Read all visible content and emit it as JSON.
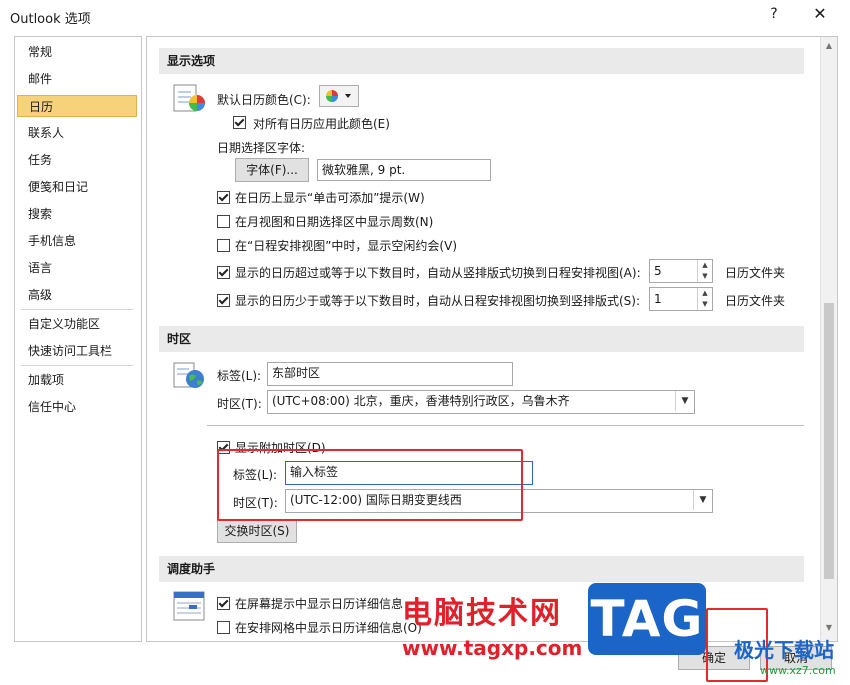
{
  "window": {
    "title": "Outlook 选项",
    "help": "?",
    "close": "✕"
  },
  "nav": {
    "items": [
      {
        "label": "常规"
      },
      {
        "label": "邮件"
      },
      {
        "label": "日历"
      },
      {
        "label": "联系人"
      },
      {
        "label": "任务"
      },
      {
        "label": "便笺和日记"
      },
      {
        "label": "搜索"
      },
      {
        "label": "手机信息"
      },
      {
        "label": "语言"
      },
      {
        "label": "高级"
      },
      {
        "label": "自定义功能区"
      },
      {
        "label": "快速访问工具栏"
      },
      {
        "label": "加载项"
      },
      {
        "label": "信任中心"
      }
    ],
    "selected": "日历"
  },
  "display": {
    "header": "显示选项",
    "default_color_label": "默认日历颜色(C):",
    "apply_all_label": "对所有日历应用此颜色(E)",
    "apply_all_checked": true,
    "date_font_label": "日期选择区字体:",
    "font_button": "字体(F)...",
    "font_value": "微软雅黑, 9 pt.",
    "show_click_add_label": "在日历上显示“单击可添加”提示(W)",
    "show_click_add_checked": true,
    "show_week_num_label": "在月视图和日期选择区中显示周数(N)",
    "show_week_num_checked": false,
    "show_free_label": "在“日程安排视图”中时，显示空闲约会(V)",
    "show_free_checked": false,
    "switch_to_schedule_label": "显示的日历超过或等于以下数目时，自动从竖排版式切换到日程安排视图(A):",
    "switch_to_schedule_checked": true,
    "switch_to_schedule_value": "5",
    "switch_to_schedule_unit": "日历文件夹",
    "switch_to_vertical_label": "显示的日历少于或等于以下数目时，自动从日程安排视图切换到竖排版式(S):",
    "switch_to_vertical_checked": true,
    "switch_to_vertical_value": "1",
    "switch_to_vertical_unit": "日历文件夹"
  },
  "timezone": {
    "header": "时区",
    "label_label": "标签(L):",
    "label_value": "东部时区",
    "zone_label": "时区(T):",
    "zone_value": "(UTC+08:00) 北京，重庆，香港特别行政区，乌鲁木齐",
    "show_second_label": "显示附加时区(D)",
    "show_second_checked": true,
    "second_label_label": "标签(L):",
    "second_label_value": "输入标签",
    "second_zone_label": "时区(T):",
    "second_zone_value": "(UTC-12:00) 国际日期变更线西",
    "swap_button": "交换时区(S)"
  },
  "scheduling": {
    "header": "调度助手",
    "screen_tip_label": "在屏幕提示中显示日历详细信息",
    "screen_tip_checked": true,
    "grid_label": "在安排网格中显示日历详细信息(O)",
    "grid_checked": false
  },
  "footer": {
    "ok": "确定",
    "cancel": "取消"
  },
  "watermark": {
    "cn": "电脑技术网",
    "url": "www.tagxp.com",
    "tag": "TAG",
    "site2": "极光下载站",
    "site2_url": "www.xz7.com"
  },
  "colors": {
    "nav_selected": "#f6d37a",
    "highlight_red": "#e32b2b",
    "watermark_red": "#e0202a",
    "watermark_blue": "#1b64c8"
  }
}
